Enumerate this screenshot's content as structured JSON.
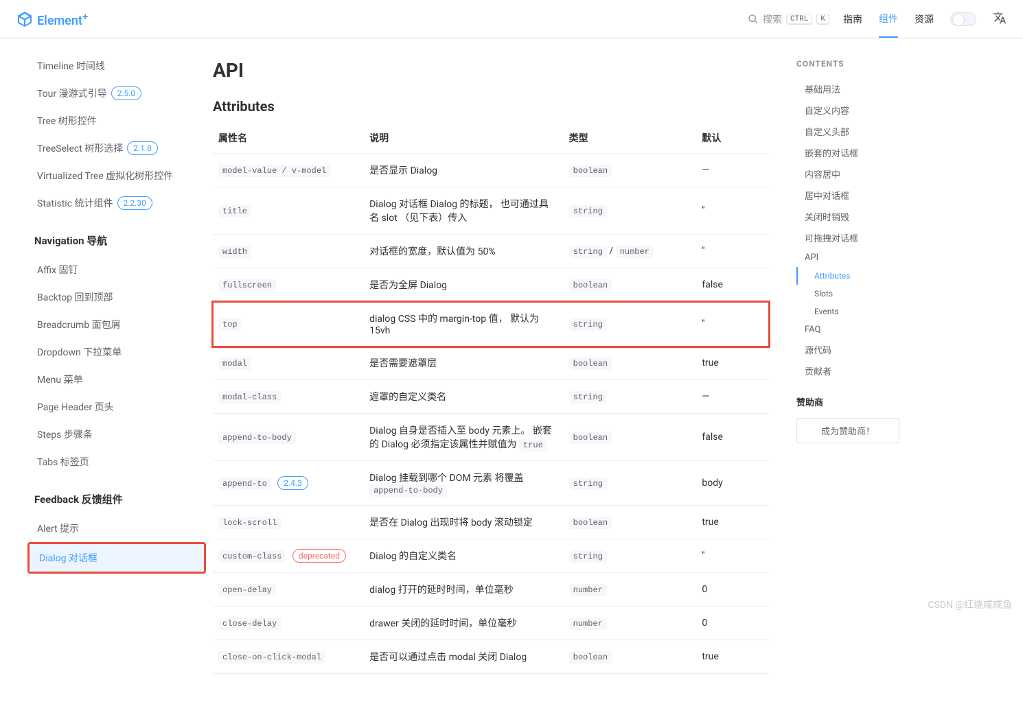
{
  "header": {
    "brand": "Element",
    "brand_sup": "+",
    "search_placeholder": "搜索",
    "kbd1": "CTRL",
    "kbd2": "K",
    "nav": {
      "guide": "指南",
      "components": "组件",
      "resources": "资源"
    }
  },
  "sidebar": {
    "top_items": [
      {
        "label": "Timeline 时间线",
        "badge": ""
      },
      {
        "label": "Tour 漫游式引导",
        "badge": "2.5.0"
      },
      {
        "label": "Tree 树形控件",
        "badge": ""
      },
      {
        "label": "TreeSelect 树形选择",
        "badge": "2.1.8"
      },
      {
        "label": "Virtualized Tree 虚拟化树形控件",
        "badge": ""
      },
      {
        "label": "Statistic 统计组件",
        "badge": "2.2.30"
      }
    ],
    "nav_title": "Navigation 导航",
    "nav_items": [
      {
        "label": "Affix 固钉"
      },
      {
        "label": "Backtop 回到顶部"
      },
      {
        "label": "Breadcrumb 面包屑"
      },
      {
        "label": "Dropdown 下拉菜单"
      },
      {
        "label": "Menu 菜单"
      },
      {
        "label": "Page Header 页头"
      },
      {
        "label": "Steps 步骤条"
      },
      {
        "label": "Tabs 标签页"
      }
    ],
    "feedback_title": "Feedback 反馈组件",
    "feedback_items": [
      {
        "label": "Alert 提示",
        "active": false
      },
      {
        "label": "Dialog 对话框",
        "active": true
      }
    ]
  },
  "main": {
    "api_heading": "API",
    "attributes_heading": "Attributes",
    "columns": {
      "name": "属性名",
      "desc": "说明",
      "type": "类型",
      "def": "默认"
    },
    "rows": [
      {
        "name": "model-value / v-model",
        "desc": "是否显示 Dialog",
        "types": [
          "boolean"
        ],
        "def": "—"
      },
      {
        "name": "title",
        "desc": "Dialog 对话框 Dialog 的标题， 也可通过具名 slot （见下表）传入",
        "types": [
          "string"
        ],
        "def": "''"
      },
      {
        "name": "width",
        "desc": "对话框的宽度，默认值为 50%",
        "types": [
          "string",
          "number"
        ],
        "def": "''"
      },
      {
        "name": "fullscreen",
        "desc": "是否为全屏 Dialog",
        "types": [
          "boolean"
        ],
        "def": "false",
        "highlight_above": true
      },
      {
        "name": "top",
        "desc": "dialog CSS 中的 margin-top 值， 默认为 15vh",
        "types": [
          "string"
        ],
        "def": "''",
        "highlight": true
      },
      {
        "name": "modal",
        "desc": "是否需要遮罩层",
        "types": [
          "boolean"
        ],
        "def": "true"
      },
      {
        "name": "modal-class",
        "desc": "遮罩的自定义类名",
        "types": [
          "string"
        ],
        "def": "—"
      },
      {
        "name": "append-to-body",
        "desc_pre": "Dialog 自身是否插入至 body 元素上。 嵌套的 Dialog 必须指定该属性并赋值为 ",
        "desc_code": "true",
        "types": [
          "boolean"
        ],
        "def": "false"
      },
      {
        "name": "append-to",
        "badge": "2.4.3",
        "desc_pre": "Dialog 挂载到哪个 DOM 元素 将覆盖 ",
        "desc_code": "append-to-body",
        "types": [
          "string"
        ],
        "def": "body"
      },
      {
        "name": "lock-scroll",
        "desc": "是否在 Dialog 出现时将 body 滚动锁定",
        "types": [
          "boolean"
        ],
        "def": "true"
      },
      {
        "name": "custom-class",
        "deprecated": "deprecated",
        "desc": "Dialog 的自定义类名",
        "types": [
          "string"
        ],
        "def": "''"
      },
      {
        "name": "open-delay",
        "desc": "dialog 打开的延时时间，单位毫秒",
        "types": [
          "number"
        ],
        "def": "0"
      },
      {
        "name": "close-delay",
        "desc": "drawer 关闭的延时时间，单位毫秒",
        "types": [
          "number"
        ],
        "def": "0"
      },
      {
        "name": "close-on-click-modal",
        "desc": "是否可以通过点击 modal 关闭 Dialog",
        "types": [
          "boolean"
        ],
        "def": "true"
      }
    ]
  },
  "toc": {
    "title": "CONTENTS",
    "items": [
      {
        "label": "基础用法",
        "sub": false
      },
      {
        "label": "自定义内容",
        "sub": false
      },
      {
        "label": "自定义头部",
        "sub": false
      },
      {
        "label": "嵌套的对话框",
        "sub": false
      },
      {
        "label": "内容居中",
        "sub": false
      },
      {
        "label": "居中对话框",
        "sub": false
      },
      {
        "label": "关闭时销毁",
        "sub": false
      },
      {
        "label": "可拖拽对话框",
        "sub": false
      },
      {
        "label": "API",
        "sub": false
      },
      {
        "label": "Attributes",
        "sub": true,
        "active": true
      },
      {
        "label": "Slots",
        "sub": true
      },
      {
        "label": "Events",
        "sub": true
      },
      {
        "label": "FAQ",
        "sub": false
      },
      {
        "label": "源代码",
        "sub": false
      },
      {
        "label": "贡献者",
        "sub": false
      }
    ],
    "sponsor_title": "赞助商",
    "sponsor_button": "成为赞助商！"
  },
  "watermark": "CSDN @红烧咸咸鱼"
}
